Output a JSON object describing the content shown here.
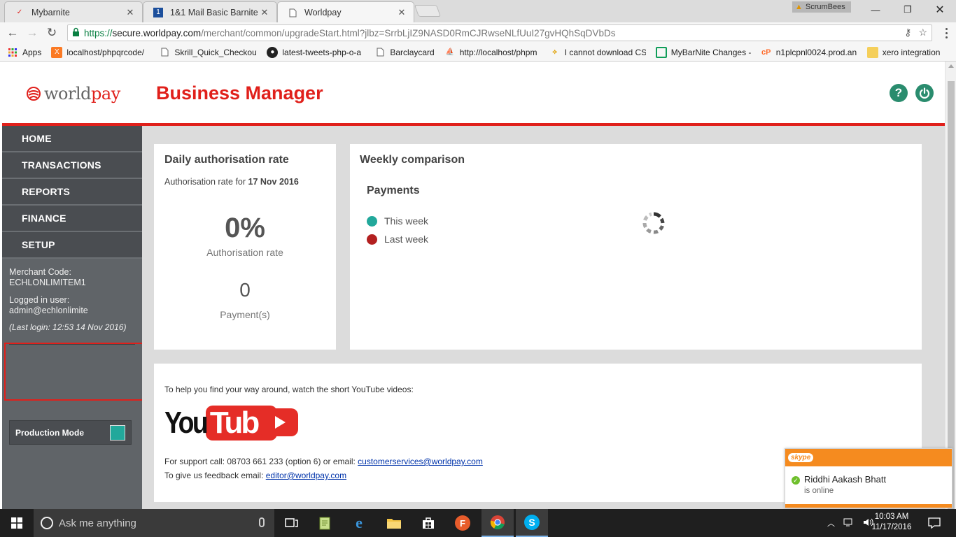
{
  "browser": {
    "tabs": [
      {
        "title": "Mybarnite"
      },
      {
        "title": "1&1 Mail Basic Barnite"
      },
      {
        "title": "Worldpay"
      }
    ],
    "profile_label": "ScrumBees",
    "url": {
      "scheme": "https://",
      "host": "secure.worldpay.com",
      "path": "/merchant/common/upgradeStart.html?jlbz=SrrbLjIZ9NASD0RmCJRwseNLfUuI27gvHQhSqDVbDs"
    },
    "bookmarks": [
      {
        "label": "Apps",
        "icon": "apps-grid-icon"
      },
      {
        "label": "localhost/phpqrcode/",
        "icon": "xampp-icon"
      },
      {
        "label": "Skrill_Quick_Checkout",
        "icon": "page-icon"
      },
      {
        "label": "latest-tweets-php-o-a",
        "icon": "github-icon"
      },
      {
        "label": "Barclaycard",
        "icon": "page-icon"
      },
      {
        "label": "http://localhost/phpm",
        "icon": "phpmyadmin-icon"
      },
      {
        "label": "I cannot download CS",
        "icon": "forum-icon"
      },
      {
        "label": "MyBarNite Changes -",
        "icon": "sheets-icon"
      },
      {
        "label": "n1plcpnl0024.prod.an",
        "icon": "cpanel-icon"
      },
      {
        "label": "xero integration",
        "icon": "folder-icon"
      }
    ]
  },
  "header": {
    "logo_world": "world",
    "logo_pay": "pay",
    "title": "Business Manager",
    "help_icon": "?",
    "colors": {
      "brand_red": "#e0201b",
      "icon_green": "#2a8c6e"
    }
  },
  "sidebar": {
    "nav": [
      {
        "label": "HOME"
      },
      {
        "label": "TRANSACTIONS"
      },
      {
        "label": "REPORTS"
      },
      {
        "label": "FINANCE"
      },
      {
        "label": "SETUP"
      }
    ],
    "merchant_code_label": "Merchant Code:",
    "merchant_code": "ECHLONLIMITEM1",
    "logged_in_label": "Logged in user:",
    "logged_in_user": "admin@echlonlimite",
    "last_login": "(Last login: 12:53 14 Nov 2016)",
    "production_mode_label": "Production Mode",
    "production_mode_color": "#22a89b"
  },
  "daily_card": {
    "title": "Daily authorisation rate",
    "subtitle_prefix": "Authorisation rate for ",
    "subtitle_date": "17 Nov 2016",
    "rate_value": "0%",
    "rate_label": "Authorisation rate",
    "payments_value": "0",
    "payments_label": "Payment(s)"
  },
  "weekly_card": {
    "title": "Weekly comparison",
    "subtitle": "Payments",
    "legend": [
      {
        "label": "This week",
        "color": "#22a89b"
      },
      {
        "label": "Last week",
        "color": "#b32020"
      }
    ]
  },
  "help_card": {
    "intro": "To help you find your way around, watch the short YouTube videos:",
    "youtube_you": "You",
    "youtube_tube": "Tube",
    "support_prefix": "For support call: 08703 661 233 (option 6) or email: ",
    "support_email": "customerservices@worldpay.com",
    "feedback_prefix": "To give us feedback email: ",
    "feedback_email": "editor@worldpay.com"
  },
  "skype_notification": {
    "brand": "skype",
    "name": "Riddhi Aakash Bhatt",
    "status": "is online",
    "color": "#f58b1f"
  },
  "taskbar": {
    "search_placeholder": "Ask me anything",
    "time": "10:03 AM",
    "date": "11/17/2016"
  }
}
